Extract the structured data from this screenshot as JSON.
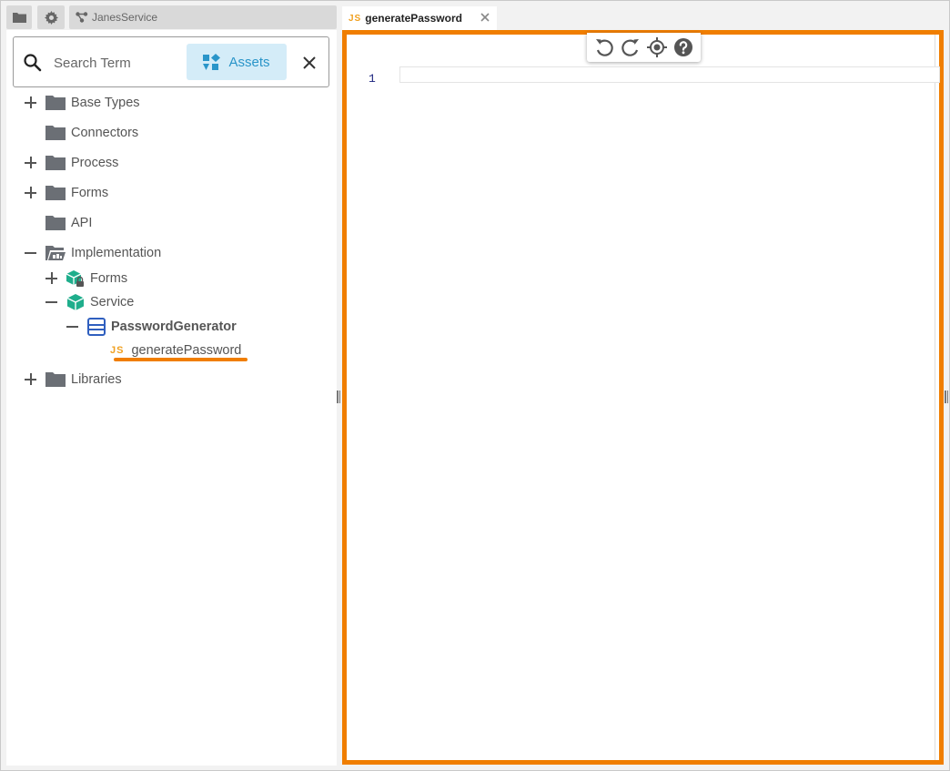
{
  "left_toolbar": {
    "folder_icon": "folder-icon",
    "gear_icon": "gear-icon",
    "breadcrumb": "JanesService"
  },
  "search": {
    "placeholder": "Search Term",
    "value": "",
    "assets_label": "Assets"
  },
  "tree": {
    "items": [
      {
        "label": "Base Types",
        "toggle": "plus"
      },
      {
        "label": "Connectors",
        "toggle": "none"
      },
      {
        "label": "Process",
        "toggle": "plus"
      },
      {
        "label": "Forms",
        "toggle": "plus"
      },
      {
        "label": "API",
        "toggle": "none"
      },
      {
        "label": "Implementation",
        "toggle": "minus"
      },
      {
        "label": "Forms",
        "toggle": "plus"
      },
      {
        "label": "Service",
        "toggle": "minus"
      },
      {
        "label": "PasswordGenerator",
        "toggle": "minus"
      },
      {
        "label": "generatePassword",
        "toggle": "none",
        "badge": "JS"
      },
      {
        "label": "Libraries",
        "toggle": "plus"
      }
    ]
  },
  "editor": {
    "tab_label": "generatePassword",
    "tab_badge": "JS",
    "line_numbers": [
      "1"
    ]
  },
  "colors": {
    "accent_orange": "#f07e00",
    "assets_blue": "#2a95c9",
    "service_green": "#1fae8c",
    "class_blue": "#2f5fbf",
    "js_yellow": "#f0a020"
  }
}
